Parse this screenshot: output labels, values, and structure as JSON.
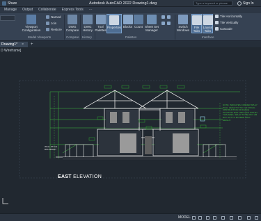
{
  "titlebar": {
    "share_label": "Share",
    "app_title": "Autodesk AutoCAD 2022   Drawing1.dwg",
    "search_placeholder": "Type a keyword or phrase",
    "signin_label": "Sign In"
  },
  "ribbon": {
    "tabs": [
      "Manage",
      "Output",
      "Collaborate",
      "Express Tools",
      "···"
    ],
    "active_tab_index": -1,
    "buttons": {
      "viewport_config": "Viewport\nConfiguration",
      "named": "Named",
      "join": "Join",
      "restore": "Restore",
      "dwg_compare": "DWG\nCompare",
      "dwg_history": "DWG\nHistory",
      "tool_palettes": "Tool\nPalettes",
      "properties": "Properties",
      "blocks": "Blocks",
      "count": "Count",
      "sheet_set_manager": "Sheet Set\nManager",
      "switch_windows": "Switch\nWindows",
      "file_tabs": "File\nTabs",
      "layout_tabs": "Layout\nTabs",
      "tile_horizontally": "Tile Horizontally",
      "tile_vertically": "Tile Vertically",
      "cascade": "Cascade"
    },
    "groups": {
      "model_viewports": "Model Viewports",
      "compare": "Compare",
      "history": "History",
      "palettes": "Palettes",
      "interface": "Interface"
    }
  },
  "doc_tabs": {
    "active": "Drawing1*",
    "close": "×",
    "add": "+"
  },
  "viewport": {
    "view_label": "D Wireframe]",
    "elevation_title_bold": "EAST",
    "elevation_title_rest": " ELEVATION",
    "notes_right": "NOTE: INDICATES CORNER SPLAY WALL HEIGHT AT NO. OF VISUAL OBSTRUCTION OR FENCE PLANTING MAX 1000 HIGH WITHIN THIS AREA. SPLAY TO BE 2M X 2M BUT NOT TO EXCEED WALL HEIGHT.",
    "notes_left": "WALL STYLE BOUNDARY"
  },
  "statusbar": {
    "model_label": "MODEL"
  },
  "colors": {
    "drawing_line": "#e8e8e8",
    "dimension_green": "#3fbf3f",
    "annotation_green": "#2fa82f",
    "accent_blue": "#4e6d92",
    "viewport_bg": "#212830"
  }
}
